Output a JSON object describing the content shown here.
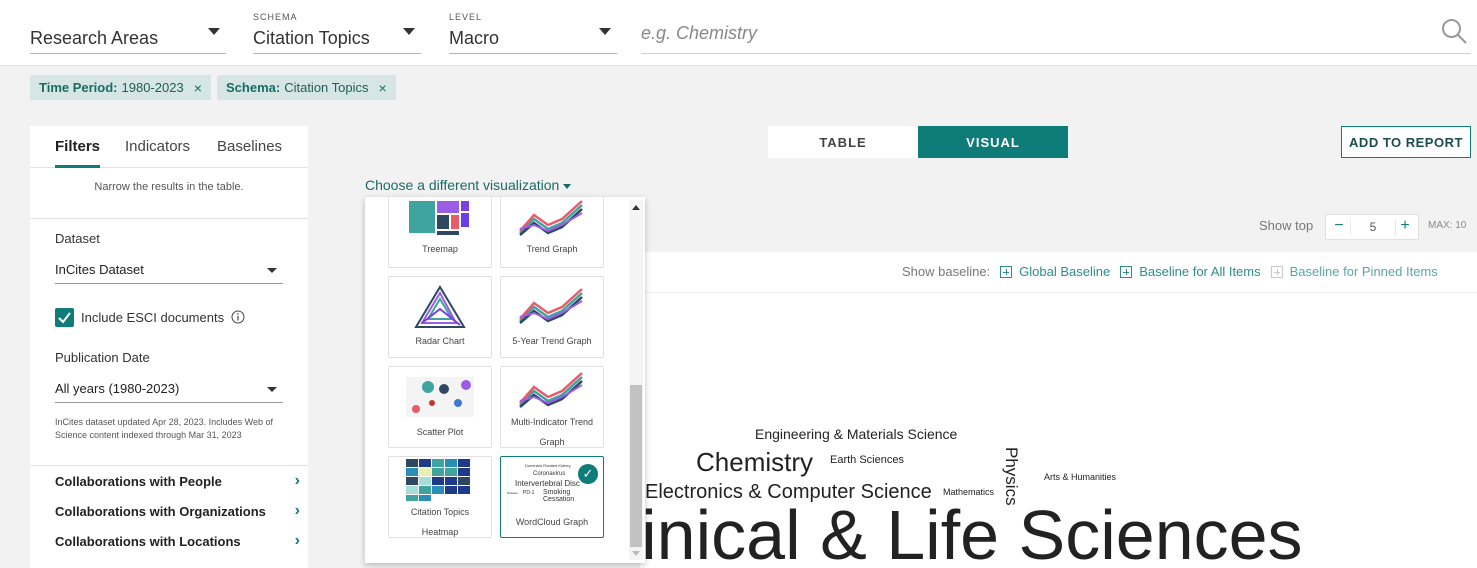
{
  "header": {
    "research_areas": {
      "value": "Research Areas"
    },
    "schema": {
      "caption": "SCHEMA",
      "value": "Citation Topics"
    },
    "level": {
      "caption": "LEVEL",
      "value": "Macro"
    },
    "search": {
      "placeholder": "e.g. Chemistry"
    }
  },
  "chips": [
    {
      "key": "Time Period:",
      "value": "1980-2023"
    },
    {
      "key": "Schema:",
      "value": "Citation Topics"
    }
  ],
  "chip_close": "×",
  "sidebar": {
    "tabs": [
      "Filters",
      "Indicators",
      "Baselines"
    ],
    "hint": "Narrow the results in the table.",
    "dataset_label": "Dataset",
    "dataset_value": "InCites Dataset",
    "esci_label": "Include ESCI documents",
    "pubdate_label": "Publication Date",
    "pubdate_value": "All years (1980-2023)",
    "note": "InCites dataset updated Apr 28, 2023. Includes Web of Science content indexed through Mar 31, 2023",
    "sections": [
      "Collaborations with People",
      "Collaborations with Organizations",
      "Collaborations with Locations"
    ]
  },
  "main": {
    "toggle_table": "TABLE",
    "toggle_visual": "VISUAL",
    "add_report": "ADD TO REPORT",
    "choose_viz": "Choose a different visualization",
    "show_top_label": "Show top",
    "show_top_value": "5",
    "stepper_minus": "−",
    "stepper_plus": "+",
    "max_label": "MAX: 10",
    "baseline_label": "Show baseline:",
    "baselines": [
      "Global Baseline",
      "Baseline for All Items",
      "Baseline for Pinned Items"
    ]
  },
  "viz_options": [
    {
      "label": "Treemap"
    },
    {
      "label": "Trend Graph"
    },
    {
      "label": "Radar Chart"
    },
    {
      "label": "5-Year Trend Graph"
    },
    {
      "label": "Scatter Plot"
    },
    {
      "label": "Multi-Indicator Trend Graph"
    },
    {
      "label": "Citation Topics Heatmap"
    },
    {
      "label": "WordCloud Graph",
      "selected": true
    }
  ],
  "thumb_words": [
    "Dominant Rotated Kidney",
    "Coronavirus",
    "Intervertebral Disc",
    "Smoking Cessation",
    "PD-1",
    "Disease"
  ],
  "wordcloud": [
    {
      "text": "Engineering & Materials Science"
    },
    {
      "text": "Chemistry"
    },
    {
      "text": "Earth Sciences"
    },
    {
      "text": "Electronics & Computer Science"
    },
    {
      "text": "Mathematics"
    },
    {
      "text": "Physics"
    },
    {
      "text": "Arts & Humanities"
    },
    {
      "text": "Clinical & Life Sciences"
    }
  ],
  "colors": {
    "accent": "#0e7c78",
    "chip_bg": "#d5e6e5"
  }
}
